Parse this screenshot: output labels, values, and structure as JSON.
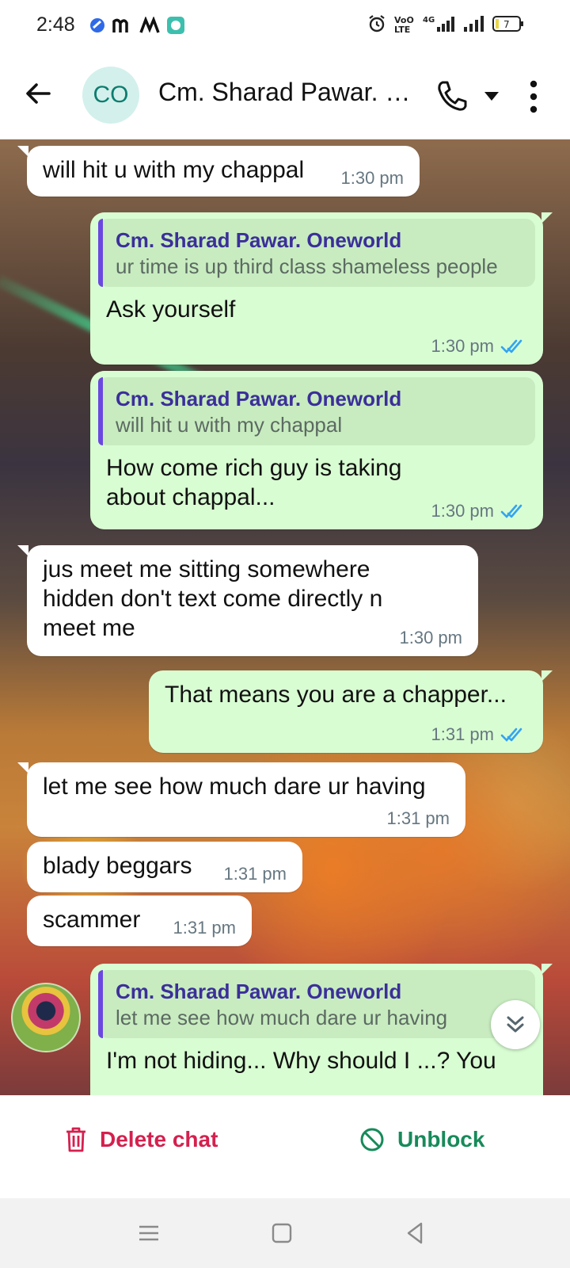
{
  "status_bar": {
    "time": "2:48",
    "battery_level": "7",
    "network_label": "4G"
  },
  "header": {
    "avatar_initials": "CO",
    "title": "Cm. Sharad Pawar. Oneworld"
  },
  "messages": [
    {
      "direction": "in",
      "text": "will hit u with my chappal",
      "time": "1:30 pm"
    },
    {
      "direction": "out",
      "quote_author": "Cm. Sharad Pawar. Oneworld",
      "quote_text": "ur time is up third class shameless people",
      "text": "Ask yourself",
      "time": "1:30 pm",
      "read": true
    },
    {
      "direction": "out",
      "quote_author": "Cm. Sharad Pawar. Oneworld",
      "quote_text": "will hit u with my chappal",
      "text": "How come rich guy is taking about chappal...",
      "time": "1:30 pm",
      "read": true
    },
    {
      "direction": "in",
      "text": "jus meet me sitting somewhere hidden don't text come directly n meet me",
      "time": "1:30 pm"
    },
    {
      "direction": "out",
      "text": "That means you are a chapper...",
      "time": "1:31 pm",
      "read": true
    },
    {
      "direction": "in",
      "text": "let me see how much dare ur having",
      "time": "1:31 pm"
    },
    {
      "direction": "in",
      "text": "blady beggars",
      "time": "1:31 pm"
    },
    {
      "direction": "in",
      "text": "scammer",
      "time": "1:31 pm"
    },
    {
      "direction": "out",
      "quote_author": "Cm. Sharad Pawar. Oneworld",
      "quote_text": "let me see how much dare ur having",
      "text": "I'm not hiding... Why should I ...? You",
      "time": "",
      "read": false
    }
  ],
  "actions": {
    "delete_label": "Delete chat",
    "unblock_label": "Unblock"
  },
  "colors": {
    "incoming_bubble": "#ffffff",
    "outgoing_bubble": "#d9fdd3",
    "read_ticks": "#34a4f1",
    "delete": "#d4204e",
    "unblock": "#178a5a"
  }
}
